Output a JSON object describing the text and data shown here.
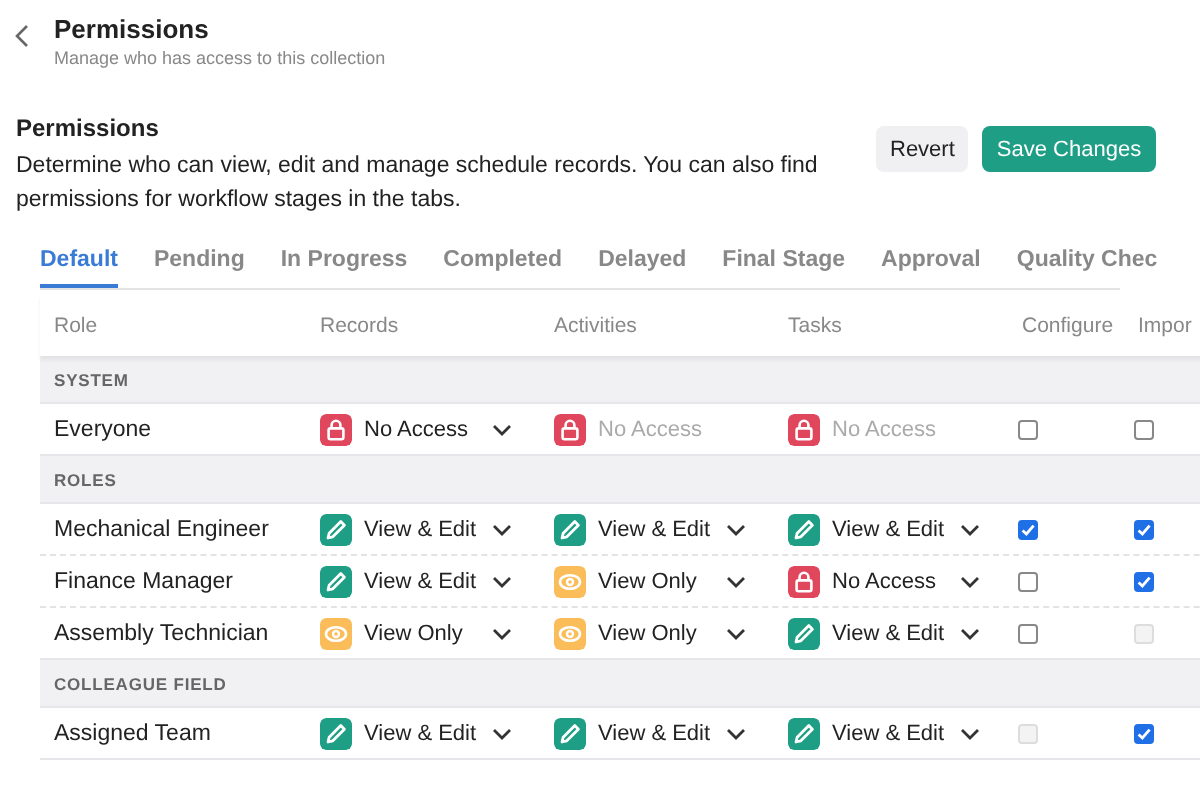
{
  "header": {
    "title": "Permissions",
    "subtitle": "Manage who has access to this collection"
  },
  "section": {
    "title": "Permissions",
    "description": "Determine who can view, edit and manage schedule records. You can also find permissions for workflow stages in the tabs."
  },
  "buttons": [
    {
      "label": "Revert",
      "kind": "secondary"
    },
    {
      "label": "Save Changes",
      "kind": "primary"
    }
  ],
  "tabs": [
    {
      "label": "Default",
      "selected": true
    },
    {
      "label": "Pending",
      "selected": false
    },
    {
      "label": "In Progress",
      "selected": false
    },
    {
      "label": "Completed",
      "selected": false
    },
    {
      "label": "Delayed",
      "selected": false
    },
    {
      "label": "Final Stage",
      "selected": false
    },
    {
      "label": "Approval",
      "selected": false
    },
    {
      "label": "Quality Chec",
      "selected": false
    }
  ],
  "table": {
    "columns": [
      "Role",
      "Records",
      "Activities",
      "Tasks",
      "Configure",
      "Impor"
    ],
    "rows": [
      {
        "kind": "group",
        "label": "SYSTEM"
      },
      {
        "kind": "role",
        "role": "Everyone",
        "access": [
          {
            "kind": "none",
            "label": "No Access",
            "disabled": false
          },
          {
            "kind": "none",
            "label": "No Access",
            "disabled": true
          },
          {
            "kind": "none",
            "label": "No Access",
            "disabled": true
          }
        ],
        "checks": [
          {
            "checked": false,
            "disabled": false
          },
          {
            "checked": false,
            "disabled": false
          }
        ]
      },
      {
        "kind": "group",
        "label": "ROLES"
      },
      {
        "kind": "role",
        "role": "Mechanical Engineer",
        "access": [
          {
            "kind": "edit",
            "label": "View & Edit",
            "disabled": false
          },
          {
            "kind": "edit",
            "label": "View & Edit",
            "disabled": false
          },
          {
            "kind": "edit",
            "label": "View & Edit",
            "disabled": false
          }
        ],
        "checks": [
          {
            "checked": true,
            "disabled": false
          },
          {
            "checked": true,
            "disabled": false
          }
        ]
      },
      {
        "kind": "role",
        "role": "Finance Manager",
        "access": [
          {
            "kind": "edit",
            "label": "View & Edit",
            "disabled": false
          },
          {
            "kind": "view",
            "label": "View Only",
            "disabled": false
          },
          {
            "kind": "none",
            "label": "No Access",
            "disabled": false
          }
        ],
        "checks": [
          {
            "checked": false,
            "disabled": false
          },
          {
            "checked": true,
            "disabled": false
          }
        ]
      },
      {
        "kind": "role",
        "role": "Assembly Technician",
        "access": [
          {
            "kind": "view",
            "label": "View Only",
            "disabled": false
          },
          {
            "kind": "view",
            "label": "View Only",
            "disabled": false
          },
          {
            "kind": "edit",
            "label": "View & Edit",
            "disabled": false
          }
        ],
        "checks": [
          {
            "checked": false,
            "disabled": false
          },
          {
            "checked": false,
            "disabled": true
          }
        ]
      },
      {
        "kind": "group",
        "label": "COLLEAGUE FIELD"
      },
      {
        "kind": "role",
        "role": "Assigned Team",
        "access": [
          {
            "kind": "edit",
            "label": "View & Edit",
            "disabled": false
          },
          {
            "kind": "edit",
            "label": "View & Edit",
            "disabled": false
          },
          {
            "kind": "edit",
            "label": "View & Edit",
            "disabled": false
          }
        ],
        "checks": [
          {
            "checked": false,
            "disabled": true
          },
          {
            "checked": true,
            "disabled": false
          }
        ]
      }
    ]
  }
}
